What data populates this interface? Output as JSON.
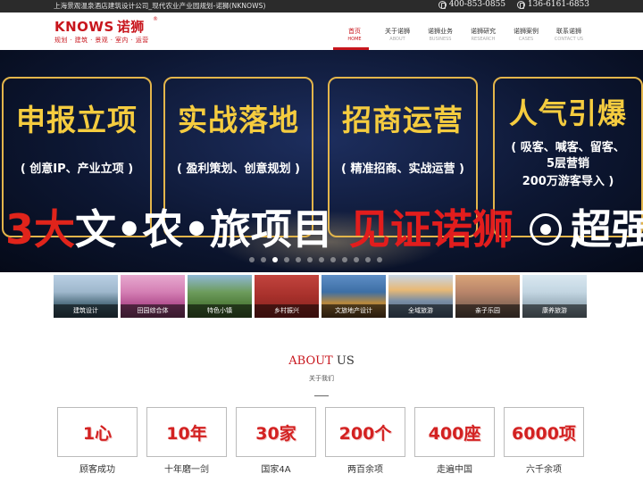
{
  "topbar": {
    "tagline": "上海景观温泉酒店建筑设计公司_现代农业产业园规划-诺狮(NKNOWS)",
    "phones": [
      "400-853-0855",
      "136-6161-6853"
    ]
  },
  "logo": {
    "brand": "KNOWS",
    "brand_cn": "诺狮",
    "reg": "®",
    "slogan": "规划 · 建筑 · 景观 · 室内 · 运营"
  },
  "nav": [
    {
      "cn": "首页",
      "en": "HOME",
      "active": true
    },
    {
      "cn": "关于诺狮",
      "en": "ABOUT"
    },
    {
      "cn": "诺狮业务",
      "en": "BUSINESS"
    },
    {
      "cn": "诺狮研究",
      "en": "RESEARCH"
    },
    {
      "cn": "诺狮案例",
      "en": "CASES"
    },
    {
      "cn": "联系诺狮",
      "en": "CONTACT US"
    }
  ],
  "banner": {
    "cards": [
      {
        "title": "申报立项",
        "sub": "( 创意IP、产业立项 )"
      },
      {
        "title": "实战落地",
        "sub": "( 盈利策划、创意规划 )"
      },
      {
        "title": "招商运营",
        "sub": "( 精准招商、实战运营 )"
      },
      {
        "title": "人气引爆",
        "sub": "( 吸客、喊客、留客、",
        "sub2": "5层营销",
        "sub3": "200万游客导入 )"
      }
    ],
    "big_line": {
      "part1": "3大",
      "part2": "文•农•旅项目",
      "part3": "见证诺狮",
      "part4": "超强落地"
    },
    "slides_total": 12,
    "slide_active": 3
  },
  "thumbs": [
    {
      "caption": "建筑设计"
    },
    {
      "caption": "田园综合体"
    },
    {
      "caption": "特色小镇"
    },
    {
      "caption": "乡村振兴"
    },
    {
      "caption": "文旅地产设计"
    },
    {
      "caption": "全域旅游"
    },
    {
      "caption": "亲子乐园"
    },
    {
      "caption": "康养旅游"
    }
  ],
  "about": {
    "title_1": "ABOUT",
    "title_2": " US",
    "subtitle": "关于我们"
  },
  "stats": [
    {
      "num": "1心",
      "label": "顾客成功"
    },
    {
      "num": "10年",
      "label": "十年磨一剑"
    },
    {
      "num": "30家",
      "label": "国家4A"
    },
    {
      "num": "200个",
      "label": "两百余项"
    },
    {
      "num": "400座",
      "label": "走遍中国"
    },
    {
      "num": "6000项",
      "label": "六千余项"
    }
  ]
}
